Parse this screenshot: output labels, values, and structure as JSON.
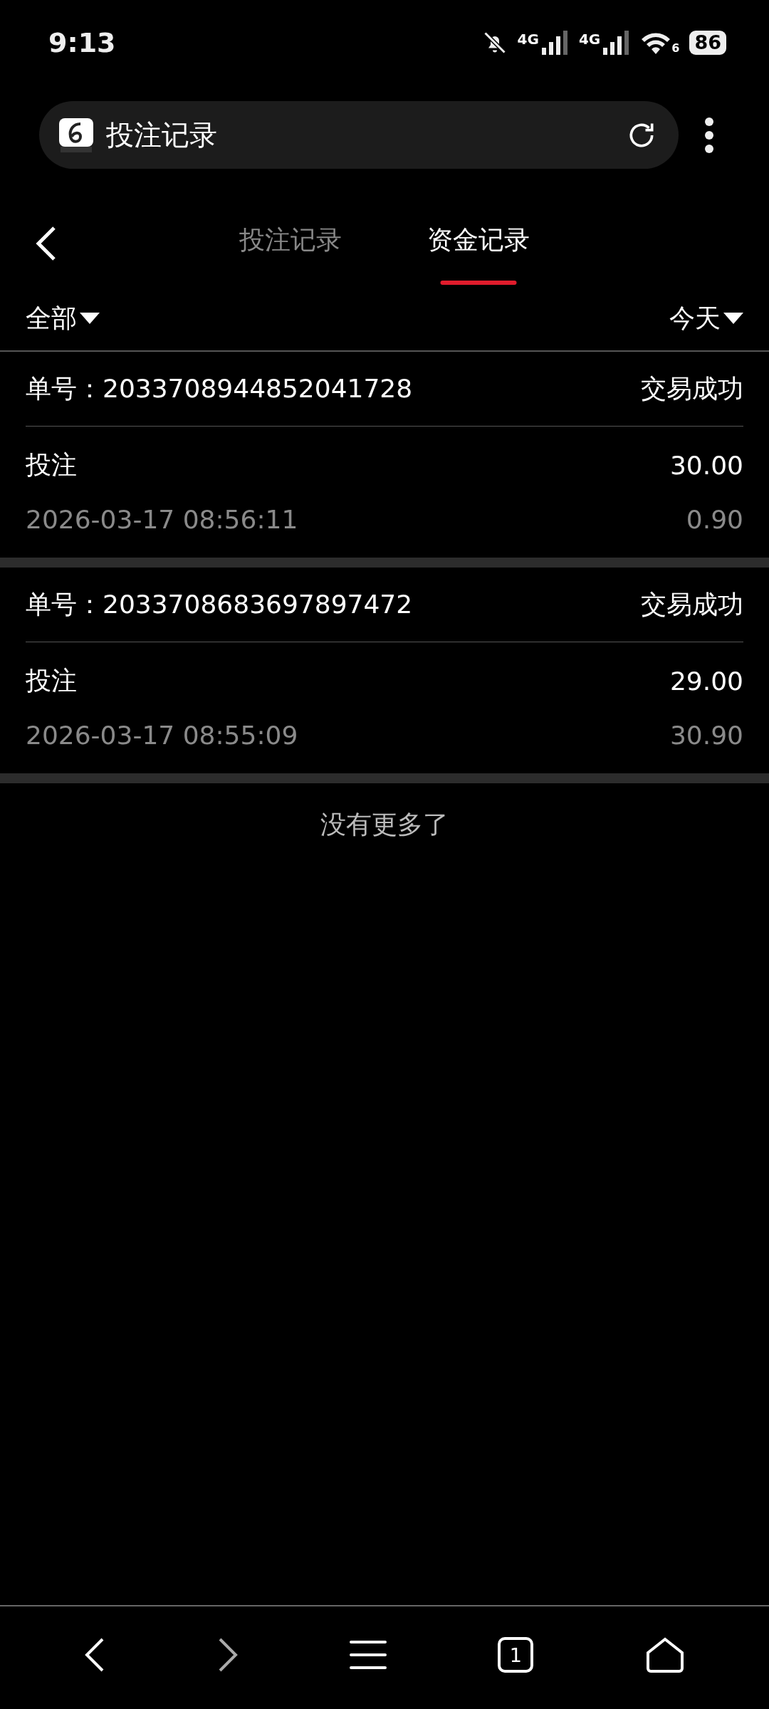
{
  "status_bar": {
    "time": "9:13",
    "signals": [
      {
        "label": "4G"
      },
      {
        "label": "4G"
      }
    ],
    "wifi_label": "6",
    "battery": "86"
  },
  "address_bar": {
    "title": "投注记录"
  },
  "tabs": [
    {
      "label": "投注记录",
      "selected": false
    },
    {
      "label": "资金记录",
      "selected": true
    }
  ],
  "filters": {
    "left": "全部",
    "right": "今天"
  },
  "records": [
    {
      "order_label": "单号：",
      "order_no": "2033708944852041728",
      "status": "交易成功",
      "type": "投注",
      "amount": "30.00",
      "time": "2026-03-17 08:56:11",
      "balance": "0.90"
    },
    {
      "order_label": "单号：",
      "order_no": "2033708683697897472",
      "status": "交易成功",
      "type": "投注",
      "amount": "29.00",
      "time": "2026-03-17 08:55:09",
      "balance": "30.90"
    }
  ],
  "end_note": "没有更多了",
  "bottom_bar": {
    "tab_count": "1"
  }
}
